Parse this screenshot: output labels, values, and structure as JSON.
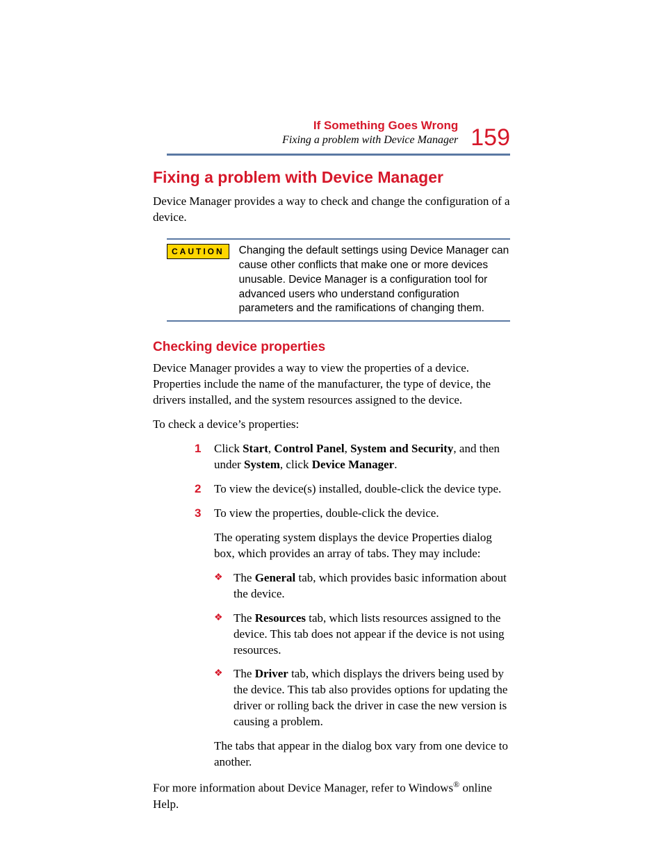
{
  "header": {
    "chapter": "If Something Goes Wrong",
    "section": "Fixing a problem with Device Manager",
    "page_number": "159"
  },
  "h1": "Fixing a problem with Device Manager",
  "intro": "Device Manager provides a way to check and change the configuration of a device.",
  "caution": {
    "label": "CAUTION",
    "text": "Changing the default settings using Device Manager can cause other conflicts that make one or more devices unusable. Device Manager is a configuration tool for advanced users who understand configuration parameters and the ramifications of changing them."
  },
  "h2": "Checking device properties",
  "p1": "Device Manager provides a way to view the properties of a device. Properties include the name of the manufacturer, the type of device, the drivers installed, and the system resources assigned to the device.",
  "p2": "To check a device’s properties:",
  "steps": {
    "s1_a": "Click ",
    "s1_b1": "Start",
    "s1_c": ", ",
    "s1_b2": "Control Panel",
    "s1_d": ", ",
    "s1_b3": "System and Security",
    "s1_e": ", and then under ",
    "s1_b4": "System",
    "s1_f": ", click ",
    "s1_b5": "Device Manager",
    "s1_g": ".",
    "s2": "To view the device(s) installed, double-click the device type.",
    "s3": "To view the properties, double-click the device.",
    "s3_after": "The operating system displays the device Properties dialog box, which provides an array of tabs. They may include:",
    "b1_a": "The ",
    "b1_bold": "General",
    "b1_b": " tab, which provides basic information about the device.",
    "b2_a": "The ",
    "b2_bold": "Resources",
    "b2_b": " tab, which lists resources assigned to the device. This tab does not appear if the device is not using resources.",
    "b3_a": "The ",
    "b3_bold": "Driver",
    "b3_b": " tab, which displays the drivers being used by the device. This tab also provides options for updating the driver or rolling back the driver in case the new version is causing a problem.",
    "tabs_vary": "The tabs that appear in the dialog box vary from one device to another."
  },
  "footer_a": "For more information about Device Manager, refer to Windows",
  "footer_sup": "®",
  "footer_b": " online Help."
}
